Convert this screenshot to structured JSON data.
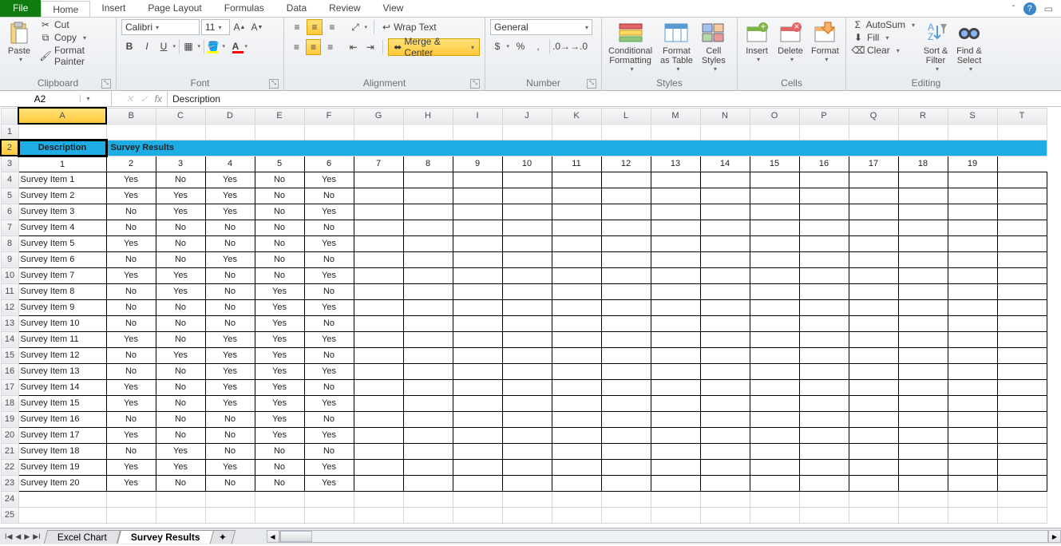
{
  "menu": {
    "file": "File",
    "tabs": [
      "Home",
      "Insert",
      "Page Layout",
      "Formulas",
      "Data",
      "Review",
      "View"
    ],
    "active": "Home"
  },
  "clipboard": {
    "paste": "Paste",
    "cut": "Cut",
    "copy": "Copy",
    "formatpainter": "Format Painter",
    "caption": "Clipboard"
  },
  "font": {
    "name": "Calibri",
    "size": "11",
    "bold": "B",
    "italic": "I",
    "underline": "U",
    "caption": "Font"
  },
  "alignment": {
    "wrap": "Wrap Text",
    "merge": "Merge & Center",
    "caption": "Alignment"
  },
  "number": {
    "format": "General",
    "currency": "$",
    "percent": "%",
    "comma": ",",
    "caption": "Number"
  },
  "styles": {
    "cond": "Conditional\nFormatting",
    "table": "Format\nas Table",
    "cell": "Cell\nStyles",
    "caption": "Styles"
  },
  "cells": {
    "insert": "Insert",
    "delete": "Delete",
    "format": "Format",
    "caption": "Cells"
  },
  "editing": {
    "autosum": "AutoSum",
    "fill": "Fill",
    "clear": "Clear",
    "sort": "Sort &\nFilter",
    "find": "Find &\nSelect",
    "caption": "Editing"
  },
  "namebox": "A2",
  "formula": "Description",
  "columns": [
    "A",
    "B",
    "C",
    "D",
    "E",
    "F",
    "G",
    "H",
    "I",
    "J",
    "K",
    "L",
    "M",
    "N",
    "O",
    "P",
    "Q",
    "R",
    "S",
    "T"
  ],
  "lastColDataIndex": 19,
  "headerRow1": {
    "A2": "Description",
    "B2": "Survey Results"
  },
  "headerRow2": [
    "1",
    "2",
    "3",
    "4",
    "5",
    "6",
    "7",
    "8",
    "9",
    "10",
    "11",
    "12",
    "13",
    "14",
    "15",
    "16",
    "17",
    "18",
    "19"
  ],
  "data": [
    {
      "item": "Survey Item 1",
      "vals": [
        "Yes",
        "No",
        "Yes",
        "No",
        "Yes"
      ]
    },
    {
      "item": "Survey Item 2",
      "vals": [
        "Yes",
        "Yes",
        "Yes",
        "No",
        "No"
      ]
    },
    {
      "item": "Survey Item 3",
      "vals": [
        "No",
        "Yes",
        "Yes",
        "No",
        "Yes"
      ]
    },
    {
      "item": "Survey Item 4",
      "vals": [
        "No",
        "No",
        "No",
        "No",
        "No"
      ]
    },
    {
      "item": "Survey Item 5",
      "vals": [
        "Yes",
        "No",
        "No",
        "No",
        "Yes"
      ]
    },
    {
      "item": "Survey Item 6",
      "vals": [
        "No",
        "No",
        "Yes",
        "No",
        "No"
      ]
    },
    {
      "item": "Survey Item 7",
      "vals": [
        "Yes",
        "Yes",
        "No",
        "No",
        "Yes"
      ]
    },
    {
      "item": "Survey Item 8",
      "vals": [
        "No",
        "Yes",
        "No",
        "Yes",
        "No"
      ]
    },
    {
      "item": "Survey Item 9",
      "vals": [
        "No",
        "No",
        "No",
        "Yes",
        "Yes"
      ]
    },
    {
      "item": "Survey Item 10",
      "vals": [
        "No",
        "No",
        "No",
        "Yes",
        "No"
      ]
    },
    {
      "item": "Survey Item 11",
      "vals": [
        "Yes",
        "No",
        "Yes",
        "Yes",
        "Yes"
      ]
    },
    {
      "item": "Survey Item 12",
      "vals": [
        "No",
        "Yes",
        "Yes",
        "Yes",
        "No"
      ]
    },
    {
      "item": "Survey Item 13",
      "vals": [
        "No",
        "No",
        "Yes",
        "Yes",
        "Yes"
      ]
    },
    {
      "item": "Survey Item 14",
      "vals": [
        "Yes",
        "No",
        "Yes",
        "Yes",
        "No"
      ]
    },
    {
      "item": "Survey Item 15",
      "vals": [
        "Yes",
        "No",
        "Yes",
        "Yes",
        "Yes"
      ]
    },
    {
      "item": "Survey Item 16",
      "vals": [
        "No",
        "No",
        "No",
        "Yes",
        "No"
      ]
    },
    {
      "item": "Survey Item 17",
      "vals": [
        "Yes",
        "No",
        "No",
        "Yes",
        "Yes"
      ]
    },
    {
      "item": "Survey Item 18",
      "vals": [
        "No",
        "Yes",
        "No",
        "No",
        "No"
      ]
    },
    {
      "item": "Survey Item 19",
      "vals": [
        "Yes",
        "Yes",
        "Yes",
        "No",
        "Yes"
      ]
    },
    {
      "item": "Survey Item 20",
      "vals": [
        "Yes",
        "No",
        "No",
        "No",
        "Yes"
      ]
    }
  ],
  "sheets": {
    "s1": "Excel Chart",
    "s2": "Survey Results"
  }
}
